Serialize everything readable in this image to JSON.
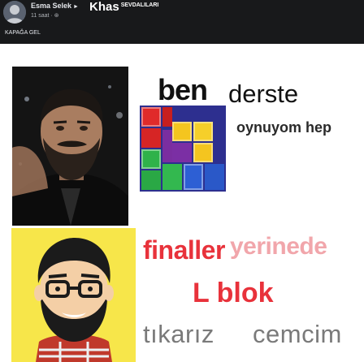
{
  "post": {
    "author": "Esma Selek",
    "author_arrow": "►",
    "group_name": "Khas",
    "group_sub": "SEVDALILARI",
    "time": "11 saat · ⊛",
    "text": "KAPAĞA GEL",
    "avatar_icon": "user-avatar-icon"
  },
  "meme": {
    "top_left_image": "bearded-man-photo",
    "ben": "ben",
    "derste": "derste",
    "oynuyom": "oynuyom hep",
    "tetris_image": "tetris-blocks-image",
    "cartoon_image": "bearded-glasses-cartoon",
    "finaller": "finaller",
    "yerinede": "yerinede",
    "lblok": "L blok",
    "tikariz": "tıkarız",
    "cemcim": "cemcim"
  },
  "colors": {
    "header_bg": "#18191b",
    "red_text": "#e8323b",
    "pink_text": "#f1a6ab",
    "gray_text": "#7a7a7a",
    "yellow_bg": "#f7e64a"
  }
}
